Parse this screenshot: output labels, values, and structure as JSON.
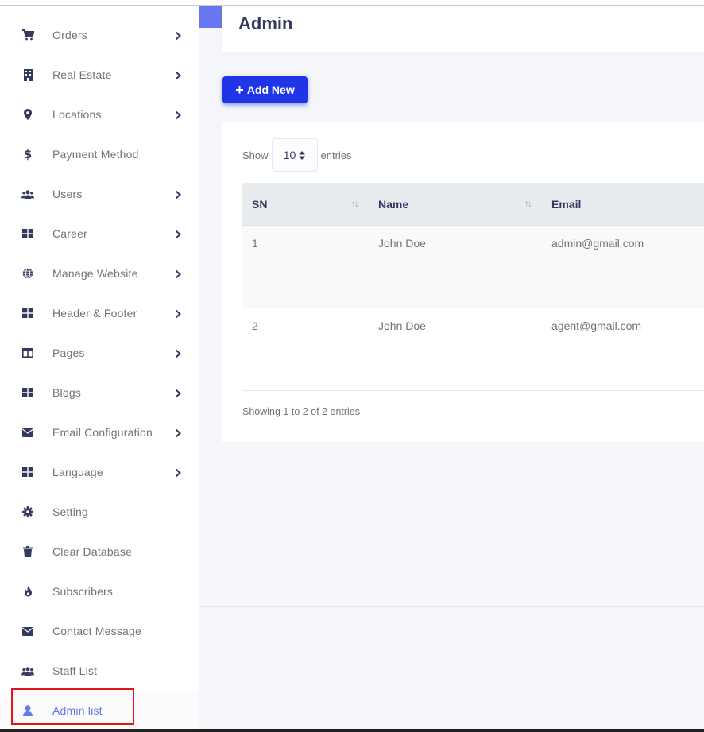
{
  "sidebar": {
    "items": [
      {
        "label": "Orders",
        "icon": "cart-icon",
        "name": "sidebar-item-orders",
        "chevron": true
      },
      {
        "label": "Real Estate",
        "icon": "building-icon",
        "name": "sidebar-item-real-estate",
        "chevron": true
      },
      {
        "label": "Locations",
        "icon": "map-pin-icon",
        "name": "sidebar-item-locations",
        "chevron": true
      },
      {
        "label": "Payment Method",
        "icon": "dollar-icon",
        "name": "sidebar-item-payment-method",
        "chevron": false
      },
      {
        "label": "Users",
        "icon": "users-icon",
        "name": "sidebar-item-users",
        "chevron": true
      },
      {
        "label": "Career",
        "icon": "grid-icon",
        "name": "sidebar-item-career",
        "chevron": true
      },
      {
        "label": "Manage Website",
        "icon": "globe-icon",
        "name": "sidebar-item-manage-website",
        "chevron": true
      },
      {
        "label": "Header & Footer",
        "icon": "grid-icon",
        "name": "sidebar-item-header-footer",
        "chevron": true
      },
      {
        "label": "Pages",
        "icon": "columns-icon",
        "name": "sidebar-item-pages",
        "chevron": true
      },
      {
        "label": "Blogs",
        "icon": "grid-icon",
        "name": "sidebar-item-blogs",
        "chevron": true
      },
      {
        "label": "Email Configuration",
        "icon": "envelope-icon",
        "name": "sidebar-item-email-configuration",
        "chevron": true
      },
      {
        "label": "Language",
        "icon": "grid-icon",
        "name": "sidebar-item-language",
        "chevron": true
      },
      {
        "label": "Setting",
        "icon": "gear-icon",
        "name": "sidebar-item-setting",
        "chevron": false
      },
      {
        "label": "Clear Database",
        "icon": "trash-icon",
        "name": "sidebar-item-clear-database",
        "chevron": false
      },
      {
        "label": "Subscribers",
        "icon": "fire-icon",
        "name": "sidebar-item-subscribers",
        "chevron": false
      },
      {
        "label": "Contact Message",
        "icon": "envelope-icon",
        "name": "sidebar-item-contact-message",
        "chevron": false
      },
      {
        "label": "Staff List",
        "icon": "users-icon",
        "name": "sidebar-item-staff-list",
        "chevron": false
      },
      {
        "label": "Admin list",
        "icon": "user-icon",
        "name": "sidebar-item-admin-list",
        "chevron": false,
        "active": true
      }
    ]
  },
  "header": {
    "title": "Admin"
  },
  "toolbar": {
    "add_label": "Add New",
    "add_icon": "plus-icon"
  },
  "table": {
    "show_label": "Show",
    "entries_label": "entries",
    "page_length": "10",
    "columns": [
      "SN",
      "Name",
      "Email"
    ],
    "rows": [
      {
        "sn": "1",
        "name": "John Doe",
        "email": "admin@gmail.com"
      },
      {
        "sn": "2",
        "name": "John Doe",
        "email": "agent@gmail.com"
      }
    ],
    "info": "Showing 1 to 2 of 2 entries"
  },
  "colors": {
    "accent": "#6777ef",
    "button": "#2034e8",
    "highlight": "#e3141b",
    "icon": "#34395e",
    "muted_text": "#6c757d"
  }
}
